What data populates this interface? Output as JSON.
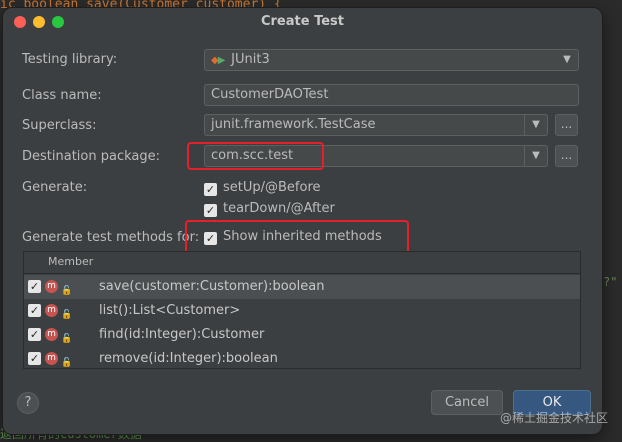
{
  "background": {
    "code_line_top": "ic boolean save(Customer customer) {",
    "code_line_bottom": "返回所有的customer数据",
    "code_right_fragment": "?\"",
    "watermark": "@稀土掘金技术社区"
  },
  "dialog": {
    "title": "Create Test",
    "testing_library": {
      "label": "Testing library:",
      "value": "JUnit3",
      "icon": "junit-icon"
    },
    "class_name": {
      "label": "Class name:",
      "value": "CustomerDAOTest"
    },
    "superclass": {
      "label": "Superclass:",
      "value": "junit.framework.TestCase",
      "browse": "..."
    },
    "destination_package": {
      "label": "Destination package:",
      "value": "com.scc.test",
      "browse": "..."
    },
    "generate": {
      "label": "Generate:",
      "options": [
        {
          "label": "setUp/@Before",
          "checked": true
        },
        {
          "label": "tearDown/@After",
          "checked": true
        }
      ]
    },
    "generate_methods": {
      "label": "Generate test methods for:",
      "show_inherited": {
        "label": "Show inherited methods",
        "checked": true
      }
    },
    "members_table": {
      "header": "Member",
      "rows": [
        {
          "name": "save(customer:Customer):boolean",
          "checked": true,
          "selected": true
        },
        {
          "name": "list():List<Customer>",
          "checked": true,
          "selected": false
        },
        {
          "name": "find(id:Integer):Customer",
          "checked": true,
          "selected": false
        },
        {
          "name": "remove(id:Integer):boolean",
          "checked": true,
          "selected": false
        }
      ]
    },
    "help_label": "?",
    "cancel_label": "Cancel",
    "ok_label": "OK"
  },
  "colors": {
    "dialog_bg": "#3c3f41",
    "highlight": "#e5202b",
    "ok_button": "#365880"
  }
}
